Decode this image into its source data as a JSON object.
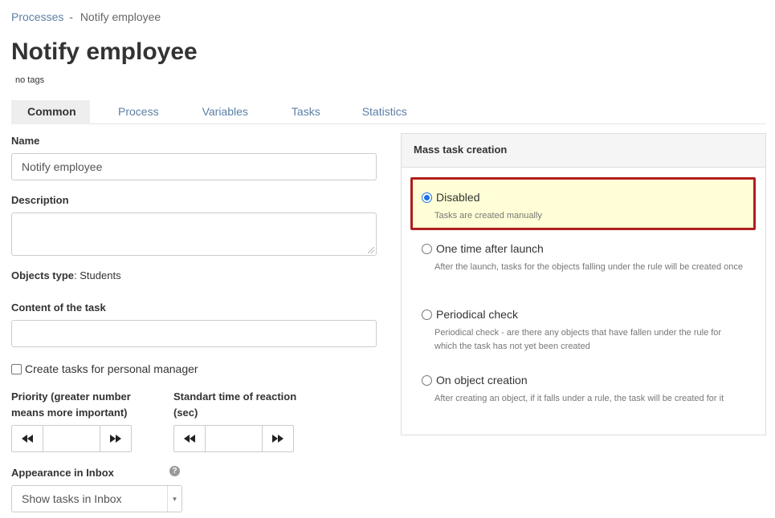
{
  "breadcrumb": {
    "parent": "Processes",
    "separator": "-",
    "current": "Notify employee"
  },
  "page": {
    "title": "Notify employee",
    "tags": "no tags"
  },
  "tabs": [
    {
      "label": "Common",
      "active": true
    },
    {
      "label": "Process",
      "active": false
    },
    {
      "label": "Variables",
      "active": false
    },
    {
      "label": "Tasks",
      "active": false
    },
    {
      "label": "Statistics",
      "active": false
    }
  ],
  "form": {
    "name_label": "Name",
    "name_value": "Notify employee",
    "description_label": "Description",
    "description_value": "",
    "objects_type_label": "Objects type",
    "objects_type_value": ": Students",
    "content_label": "Content of the task",
    "content_value": "",
    "personal_manager_label": "Create tasks for personal manager",
    "personal_manager_checked": false,
    "priority_label_line1": "Priority (greater number",
    "priority_label_line2": "means more important)",
    "priority_value": "",
    "reaction_label_line1": "Standart time of reaction",
    "reaction_label_line2": "(sec)",
    "reaction_value": "",
    "inbox_label": "Appearance in Inbox",
    "inbox_value": "Show tasks in Inbox"
  },
  "mass_task": {
    "header": "Mass task creation",
    "options": [
      {
        "title": "Disabled",
        "desc": "Tasks are created manually",
        "checked": true
      },
      {
        "title": "One time after launch",
        "desc": "After the launch, tasks for the objects falling under the rule will be created once",
        "checked": false
      },
      {
        "title": "Periodical check",
        "desc": "Periodical check - are there any objects that have fallen under the rule for which the task has not yet been created",
        "checked": false
      },
      {
        "title": "On object creation",
        "desc": "After creating an object, if it falls under a rule, the task will be created for it",
        "checked": false
      }
    ]
  },
  "icons": {
    "rewind": "rewind-icon",
    "fast_forward": "fast-forward-icon",
    "help": "help-icon",
    "dropdown": "chevron-down-icon"
  },
  "colors": {
    "link": "#5b7fa6",
    "highlight_bg": "#fffed6",
    "highlight_border": "#b01e1e",
    "radio_selected": "#1a73e8"
  }
}
